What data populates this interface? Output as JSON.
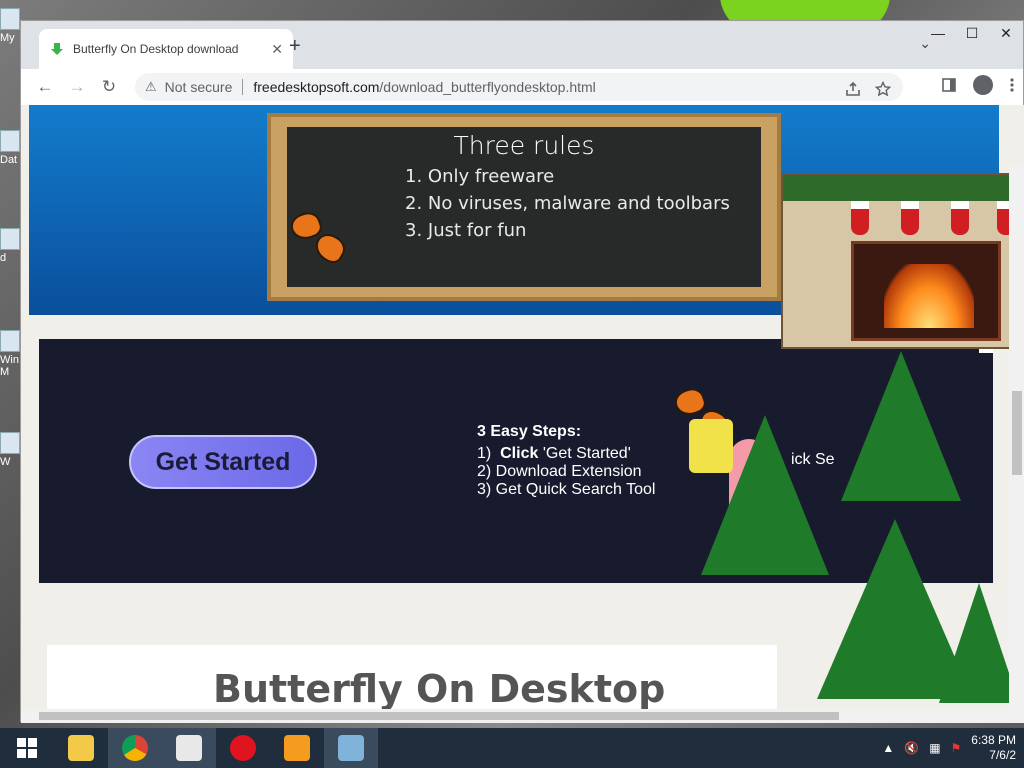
{
  "desktop": {
    "icons": [
      "My",
      "Dat",
      "d",
      "Win",
      "M",
      "W"
    ]
  },
  "browser": {
    "tab": {
      "title": "Butterfly On Desktop download",
      "close": "✕"
    },
    "newtab": "+",
    "window_controls": {
      "minimize": "—",
      "maximize": "☐",
      "close": "✕"
    },
    "tablist_chevron": "⌄",
    "nav": {
      "back": "←",
      "forward": "→",
      "reload": "↻"
    },
    "omnibox": {
      "warning": "⚠",
      "security_text": "Not secure",
      "domain": "freedesktopsoft.com",
      "path": "/download_butterflyondesktop.html"
    }
  },
  "page": {
    "chalkboard": {
      "title": "Three rules",
      "rules": [
        "1. Only freeware",
        "2. No viruses, malware and toolbars",
        "3. Just for fun"
      ]
    },
    "ad": {
      "cta": "Get Started",
      "steps_title": "3 Easy Steps:",
      "step1_num": "1)",
      "step1_bold": "Click",
      "step1_rest": " 'Get Started'",
      "step2": "2)  Download Extension",
      "step3": "3)  Get Quick Search Tool",
      "peek_text": "ick Se",
      "close": "✕"
    },
    "heading": "Butterfly On Desktop"
  },
  "taskbar": {
    "clock_time": "6:38 PM",
    "clock_date": "7/6/2"
  },
  "colors": {
    "hero_blue": "#137ccc",
    "ad_bg": "#171b2d",
    "cta_purple": "#7a77ef",
    "butterfly_orange": "#e8751a"
  }
}
